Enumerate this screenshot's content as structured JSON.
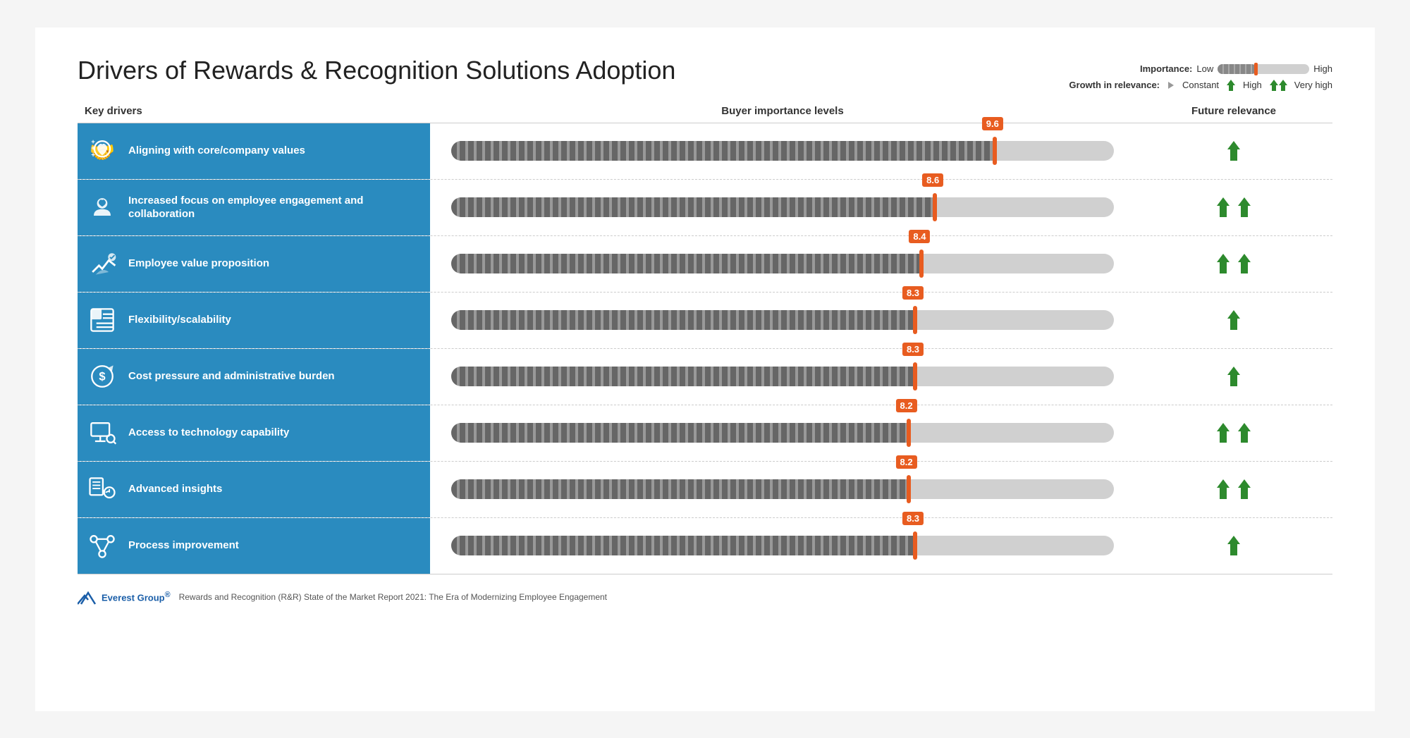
{
  "title": "Drivers of Rewards & Recognition Solutions Adoption",
  "legend": {
    "importance_label": "Importance:",
    "low": "Low",
    "high": "High",
    "growth_label": "Growth in relevance:",
    "constant": "Constant",
    "high_growth": "High",
    "very_high_growth": "Very high"
  },
  "columns": {
    "key_drivers": "Key drivers",
    "buyer_importance": "Buyer importance levels",
    "future_relevance": "Future relevance"
  },
  "rows": [
    {
      "id": "aligning",
      "label": "Aligning with core/company values",
      "value": 9.6,
      "bar_pct": 82,
      "arrows": 1,
      "icon": "values"
    },
    {
      "id": "engagement",
      "label": "Increased focus on employee engagement and collaboration",
      "value": 8.6,
      "bar_pct": 73,
      "arrows": 2,
      "icon": "engagement"
    },
    {
      "id": "evp",
      "label": "Employee value proposition",
      "value": 8.4,
      "bar_pct": 71,
      "arrows": 2,
      "icon": "evp"
    },
    {
      "id": "flexibility",
      "label": "Flexibility/scalability",
      "value": 8.3,
      "bar_pct": 70,
      "arrows": 1,
      "icon": "flexibility"
    },
    {
      "id": "cost",
      "label": "Cost pressure and administrative burden",
      "value": 8.3,
      "bar_pct": 70,
      "arrows": 1,
      "icon": "cost"
    },
    {
      "id": "technology",
      "label": "Access to technology capability",
      "value": 8.2,
      "bar_pct": 69,
      "arrows": 2,
      "icon": "technology"
    },
    {
      "id": "insights",
      "label": "Advanced insights",
      "value": 8.2,
      "bar_pct": 69,
      "arrows": 2,
      "icon": "insights"
    },
    {
      "id": "process",
      "label": "Process improvement",
      "value": 8.3,
      "bar_pct": 70,
      "arrows": 1,
      "icon": "process"
    }
  ],
  "footer": {
    "company": "Everest Group",
    "registered": "®",
    "text": "Rewards and Recognition (R&R) State of the Market Report 2021: The Era of Modernizing Employee Engagement"
  }
}
